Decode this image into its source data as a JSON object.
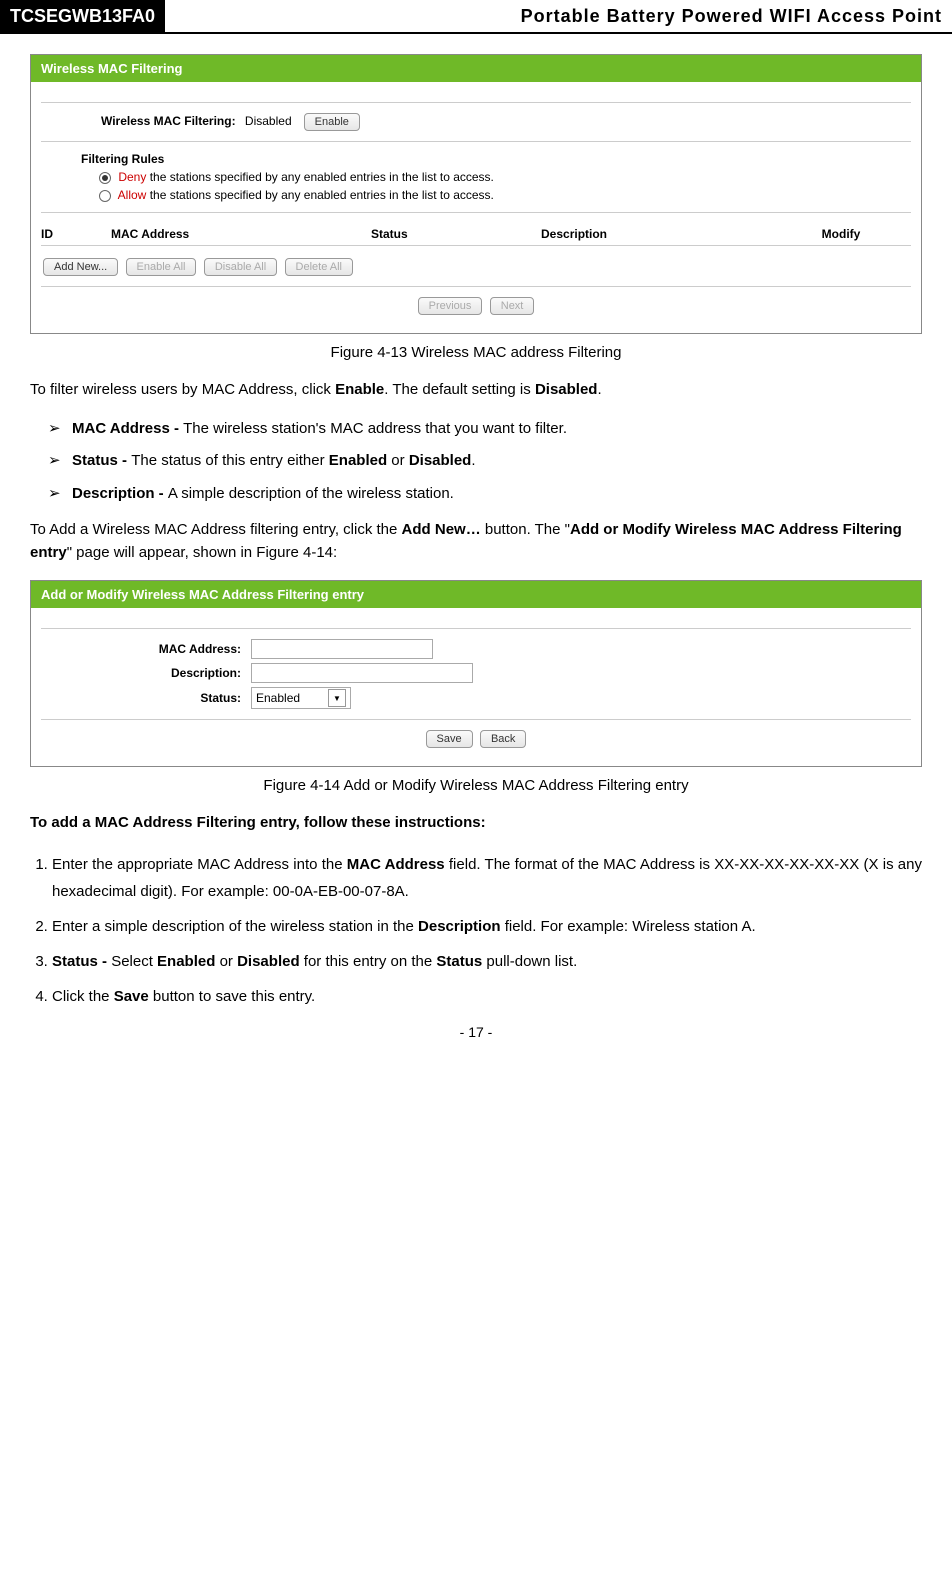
{
  "header": {
    "model": "TCSEGWB13FA0",
    "title": "Portable  Battery  Powered  WIFI  Access  Point"
  },
  "screenshot1": {
    "panel_title": "Wireless MAC Filtering",
    "filter_label": "Wireless MAC Filtering:",
    "filter_state": "Disabled",
    "enable_btn": "Enable",
    "rules_title": "Filtering Rules",
    "deny_label": "Deny",
    "deny_rest": " the stations specified by any enabled entries in the list to access.",
    "allow_label": "Allow",
    "allow_rest": " the stations specified by any enabled entries in the list to access.",
    "th": {
      "id": "ID",
      "mac": "MAC Address",
      "status": "Status",
      "desc": "Description",
      "mod": "Modify"
    },
    "btns": {
      "add": "Add New...",
      "enable_all": "Enable All",
      "disable_all": "Disable All",
      "delete_all": "Delete All",
      "prev": "Previous",
      "next": "Next"
    }
  },
  "fig1": "Figure 4-13    Wireless MAC address Filtering",
  "para1_a": "To filter wireless users by MAC Address, click ",
  "para1_b": "Enable",
  "para1_c": ". The default setting is ",
  "para1_d": "Disabled",
  "para1_e": ".",
  "bullets": {
    "b1a": "MAC Address - ",
    "b1b": "The wireless station's MAC address that you want to filter.",
    "b2a": "Status - ",
    "b2b": "The status of this entry either ",
    "b2c": "Enabled",
    "b2d": " or ",
    "b2e": "Disabled",
    "b2f": ".",
    "b3a": "Description - ",
    "b3b": "A simple description of the wireless station."
  },
  "para2_a": "To Add a Wireless MAC Address filtering entry, click the ",
  "para2_b": "Add New…",
  "para2_c": " button. The \"",
  "para2_d": "Add or Modify Wireless MAC Address Filtering entry",
  "para2_e": "\" page will appear, shown in Figure 4-14:",
  "screenshot2": {
    "panel_title": "Add or Modify Wireless MAC Address Filtering entry",
    "labels": {
      "mac": "MAC Address:",
      "desc": "Description:",
      "status": "Status:"
    },
    "status_val": "Enabled",
    "btns": {
      "save": "Save",
      "back": "Back"
    }
  },
  "fig2": "Figure 4-14    Add or Modify Wireless MAC Address Filtering entry",
  "heading2": "To add a MAC Address Filtering entry, follow these instructions:",
  "steps": {
    "s1a": "Enter the appropriate MAC Address into the ",
    "s1b": "MAC Address",
    "s1c": " field. The format of the MAC Address is XX-XX-XX-XX-XX-XX (X is any hexadecimal digit). For example: 00-0A-EB-00-07-8A.",
    "s2a": "Enter a simple description of the wireless station in the ",
    "s2b": "Description",
    "s2c": " field. For example: Wireless station A.",
    "s3a": "Status - ",
    "s3b": "Select ",
    "s3c": "Enabled",
    "s3d": " or ",
    "s3e": "Disabled",
    "s3f": " for this entry on the ",
    "s3g": "Status",
    "s3h": " pull-down list.",
    "s4a": "Click the ",
    "s4b": "Save",
    "s4c": " button to save this entry."
  },
  "page_num": "- 17 -"
}
